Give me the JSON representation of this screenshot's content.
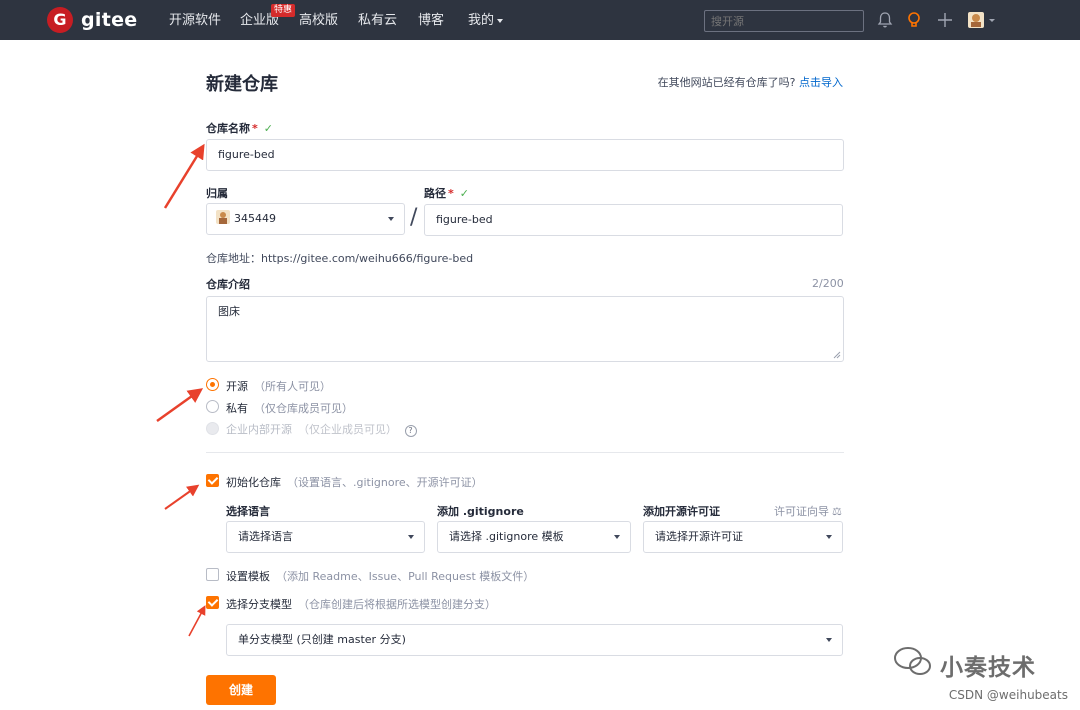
{
  "nav": {
    "logo_text": "gitee",
    "items": [
      "开源软件",
      "企业版",
      "高校版",
      "私有云",
      "博客",
      "我的"
    ],
    "badge": "特惠",
    "search_placeholder": "搜开源"
  },
  "page": {
    "title": "新建仓库",
    "import_tip": "在其他网站已经有仓库了吗?",
    "import_link": "点击导入"
  },
  "form": {
    "name_label": "仓库名称",
    "name_value": "figure-bed",
    "owner_label": "归属",
    "owner_value": "345449",
    "path_label": "路径",
    "path_value": "figure-bed",
    "slash": "/",
    "address_label": "仓库地址：",
    "address_value": "https://gitee.com/weihu666/figure-bed",
    "desc_label": "仓库介绍",
    "desc_count": "2/200",
    "desc_value": "图床",
    "visibility": [
      {
        "label": "开源",
        "note": "（所有人可见）",
        "state": "selected"
      },
      {
        "label": "私有",
        "note": "（仅仓库成员可见）",
        "state": "normal"
      },
      {
        "label": "企业内部开源",
        "note": "（仅企业成员可见）",
        "state": "disabled"
      }
    ],
    "help_glyph": "?",
    "init_label": "初始化仓库",
    "init_note": "（设置语言、.gitignore、开源许可证）",
    "lang_label": "选择语言",
    "lang_value": "请选择语言",
    "gitignore_label": "添加 .gitignore",
    "gitignore_value": "请选择 .gitignore 模板",
    "license_label": "添加开源许可证",
    "license_guide": "许可证向导",
    "license_value": "请选择开源许可证",
    "template_label": "设置模板",
    "template_note": "（添加 Readme、Issue、Pull Request 模板文件）",
    "branch_label": "选择分支模型",
    "branch_note": "（仓库创建后将根据所选模型创建分支）",
    "branch_value": "单分支模型 (只创建 master 分支)",
    "submit": "创建"
  },
  "overlay": {
    "watermark": "小奏技术",
    "csdn": "CSDN @weihubeats"
  },
  "colors": {
    "accent": "#fe7300",
    "nav_bg": "#2e3440",
    "arrow": "#e8412c",
    "check": "#4caf50"
  }
}
